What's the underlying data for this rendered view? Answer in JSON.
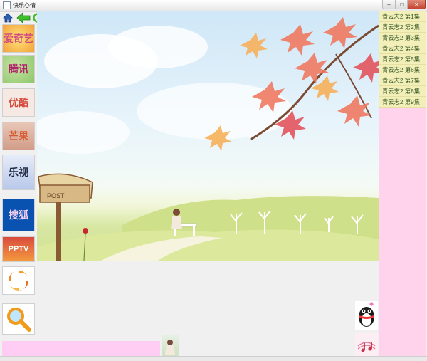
{
  "window": {
    "title": "快乐心情",
    "min_label": "–",
    "max_label": "□",
    "close_label": "✕"
  },
  "toolbar": {
    "icons": [
      "home-icon",
      "back-arrow-icon",
      "refresh-icon",
      "forward-arrow-icon"
    ]
  },
  "sources": [
    {
      "label": "爱奇艺",
      "icon": "iqiyi-logo"
    },
    {
      "label": "腾讯",
      "icon": "tencent-video-logo"
    },
    {
      "label": "优酷",
      "icon": "youku-logo"
    },
    {
      "label": "芒果",
      "icon": "mango-tv-logo"
    },
    {
      "label": "乐视",
      "icon": "letv-logo"
    },
    {
      "label": "搜狐",
      "icon": "sohu-logo"
    },
    {
      "label": "PPTV",
      "icon": "pptv-logo"
    },
    {
      "label": "",
      "icon": "swirl-logo"
    },
    {
      "label": "",
      "icon": "search-icon"
    }
  ],
  "scene": {
    "mailbox_text": "POST"
  },
  "episodes": [
    "青云志2 第1集",
    "青云志2 第2集",
    "青云志2 第3集",
    "青云志2 第4集",
    "青云志2 第5集",
    "青云志2 第6集",
    "青云志2 第7集",
    "青云志2 第8集",
    "青云志2 第9集"
  ],
  "colors": {
    "playlist_bg": "#ffd3ec",
    "episode_bg": "#f2efb8",
    "bottom_bar": "#ffcdf3"
  }
}
